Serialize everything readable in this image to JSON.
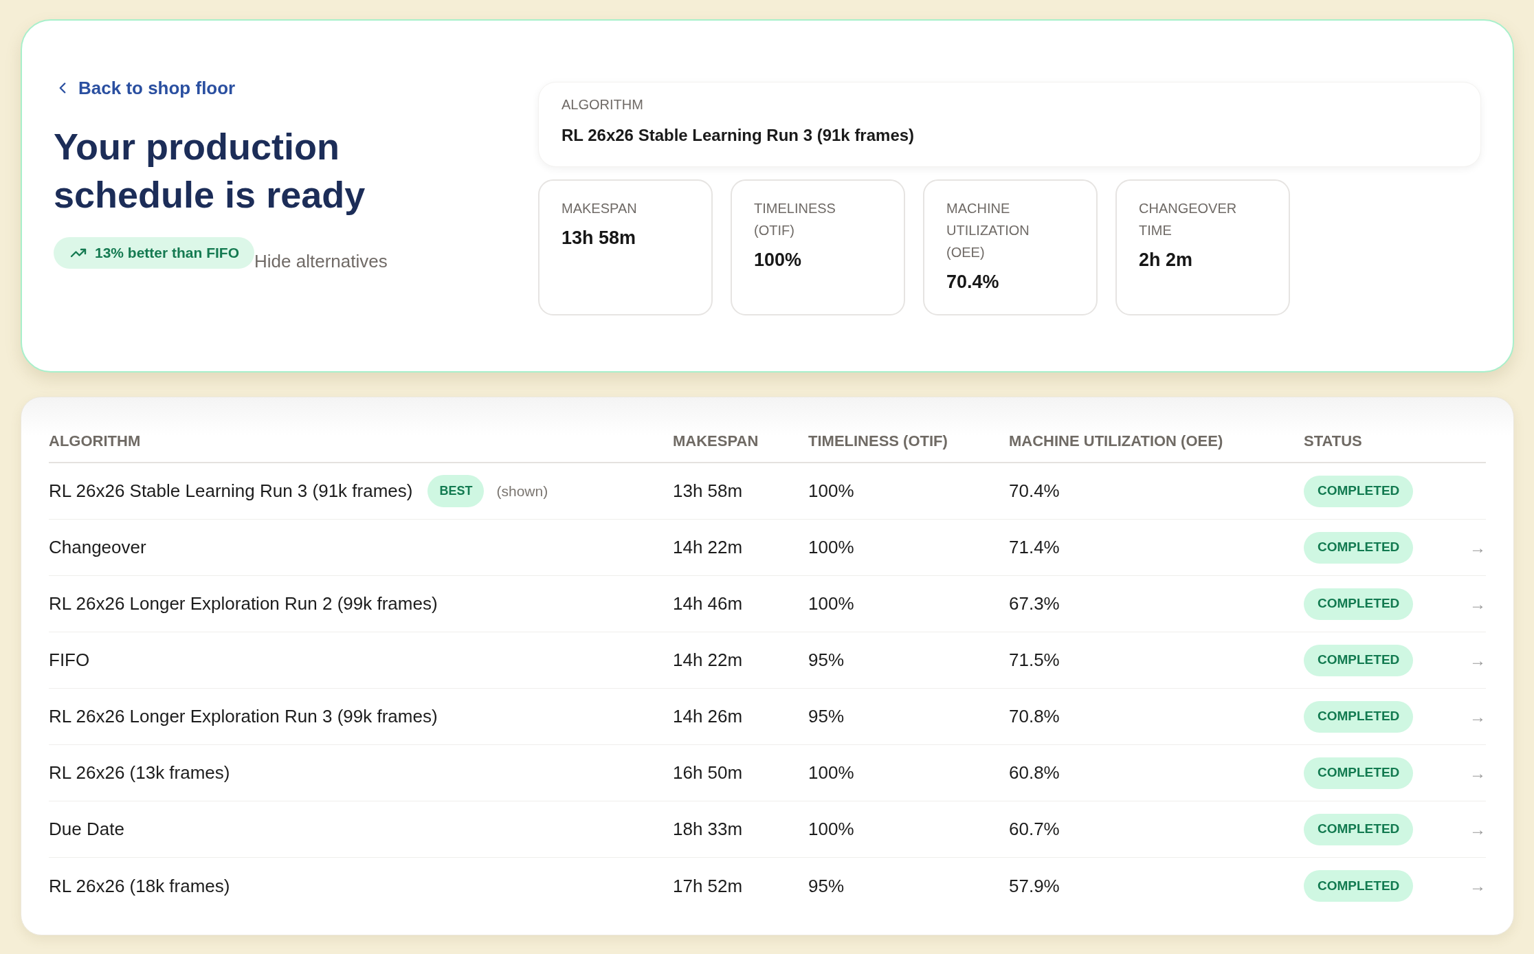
{
  "back_link": {
    "label": "Back to shop floor"
  },
  "title": "Your production schedule is ready",
  "improvement_badge": {
    "label": "13% better than FIFO"
  },
  "alternatives_toggle": {
    "label": "Hide alternatives"
  },
  "algorithm": {
    "label": "ALGORITHM",
    "value": "RL 26x26 Stable Learning Run 3 (91k frames)"
  },
  "metrics": [
    {
      "label": "MAKESPAN",
      "value": "13h 58m"
    },
    {
      "label": "TIMELINESS (OTIF)",
      "value": "100%"
    },
    {
      "label": "MACHINE UTILIZATION (OEE)",
      "value": "70.4%"
    },
    {
      "label": "CHANGEOVER TIME",
      "value": "2h 2m"
    }
  ],
  "table": {
    "columns": [
      "ALGORITHM",
      "MAKESPAN",
      "TIMELINESS (OTIF)",
      "MACHINE UTILIZATION (OEE)",
      "STATUS"
    ],
    "rows": [
      {
        "algorithm": "RL 26x26 Stable Learning Run 3 (91k frames)",
        "badge": "BEST",
        "note": "(shown)",
        "makespan": "13h 58m",
        "timeliness": "100%",
        "utilization": "70.4%",
        "status": "COMPLETED"
      },
      {
        "algorithm": "Changeover",
        "makespan": "14h 22m",
        "timeliness": "100%",
        "utilization": "71.4%",
        "status": "COMPLETED",
        "arrow": "→"
      },
      {
        "algorithm": "RL 26x26 Longer Exploration Run 2 (99k frames)",
        "makespan": "14h 46m",
        "timeliness": "100%",
        "utilization": "67.3%",
        "status": "COMPLETED",
        "arrow": "→"
      },
      {
        "algorithm": "FIFO",
        "makespan": "14h 22m",
        "timeliness": "95%",
        "utilization": "71.5%",
        "status": "COMPLETED",
        "arrow": "→"
      },
      {
        "algorithm": "RL 26x26 Longer Exploration Run 3 (99k frames)",
        "makespan": "14h 26m",
        "timeliness": "95%",
        "utilization": "70.8%",
        "status": "COMPLETED",
        "arrow": "→"
      },
      {
        "algorithm": "RL 26x26 (13k frames)",
        "makespan": "16h 50m",
        "timeliness": "100%",
        "utilization": "60.8%",
        "status": "COMPLETED",
        "arrow": "→"
      },
      {
        "algorithm": "Due Date",
        "makespan": "18h 33m",
        "timeliness": "100%",
        "utilization": "60.7%",
        "status": "COMPLETED",
        "arrow": "→"
      },
      {
        "algorithm": "RL 26x26 (18k frames)",
        "makespan": "17h 52m",
        "timeliness": "95%",
        "utilization": "57.9%",
        "status": "COMPLETED",
        "arrow": "→"
      }
    ]
  }
}
